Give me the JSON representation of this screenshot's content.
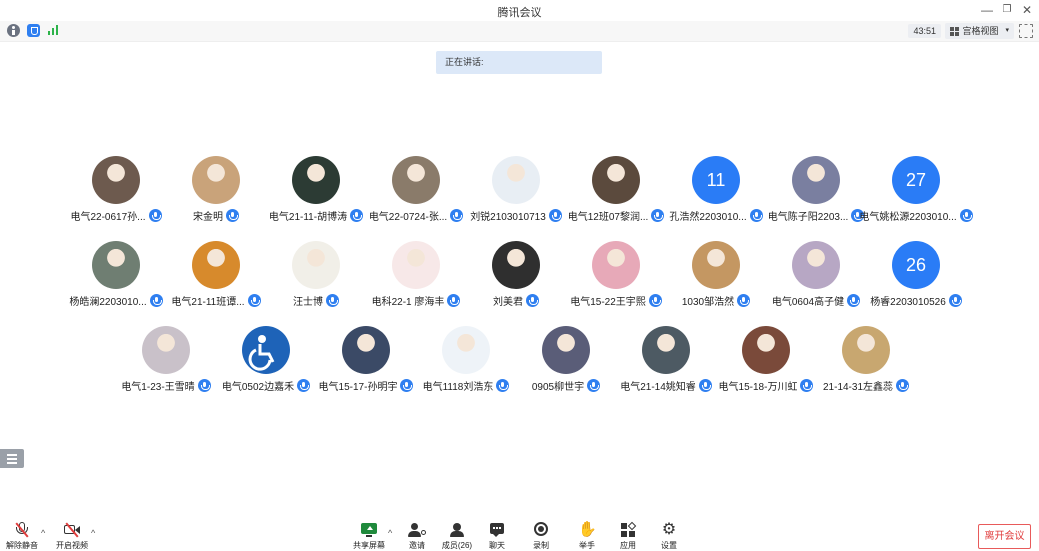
{
  "window": {
    "title": "腾讯会议"
  },
  "topbar": {
    "timer": "43:51",
    "view_label": "宫格视图"
  },
  "speaking": {
    "label": "正在讲话:"
  },
  "participants": [
    {
      "name": "电气22-0617孙...",
      "avatar": "photo",
      "color": "#6d5a4e"
    },
    {
      "name": "宋金明",
      "avatar": "photo",
      "color": "#c9a37a"
    },
    {
      "name": "电气21-11-胡博涛",
      "avatar": "photo",
      "color": "#2c3b34"
    },
    {
      "name": "电气22-0724-张...",
      "avatar": "photo",
      "color": "#8a7b6a"
    },
    {
      "name": "刘锐2103010713",
      "avatar": "photo",
      "color": "#e8eef4"
    },
    {
      "name": "电气12班07黎润...",
      "avatar": "photo",
      "color": "#5b4a3d"
    },
    {
      "name": "孔浩然2203010...",
      "avatar": "number",
      "number": "11"
    },
    {
      "name": "电气陈子阳2203...",
      "avatar": "photo",
      "color": "#7a7fa0"
    },
    {
      "name": "电气姚松源2203010...",
      "avatar": "number",
      "number": "27"
    },
    {
      "name": "杨皓澜2203010...",
      "avatar": "photo",
      "color": "#6f7e72"
    },
    {
      "name": "电气21-11班谭...",
      "avatar": "photo",
      "color": "#d78a2c"
    },
    {
      "name": "汪士博",
      "avatar": "photo",
      "color": "#f1efe8"
    },
    {
      "name": "电科22-1 廖海丰",
      "avatar": "photo",
      "color": "#f7e8e8"
    },
    {
      "name": "刘美君",
      "avatar": "photo",
      "color": "#2f2f2f"
    },
    {
      "name": "电气15-22王宇熙",
      "avatar": "photo",
      "color": "#e7a9b8"
    },
    {
      "name": "1030邹浩然",
      "avatar": "photo",
      "color": "#c49762"
    },
    {
      "name": "电气0604高子健",
      "avatar": "photo",
      "color": "#b7a7c4"
    },
    {
      "name": "杨睿2203010526",
      "avatar": "number",
      "number": "26"
    },
    {
      "name": "电气1-23-王雪晴",
      "avatar": "photo",
      "color": "#c9c1c9"
    },
    {
      "name": "电气0502边嘉禾",
      "avatar": "accessibility",
      "color": "#1e63b8"
    },
    {
      "name": "电气15-17-孙明宇",
      "avatar": "photo",
      "color": "#3b4a66"
    },
    {
      "name": "电气1118刘浩东",
      "avatar": "photo",
      "color": "#eef3f8"
    },
    {
      "name": "0905柳世宇",
      "avatar": "photo",
      "color": "#5a5d78"
    },
    {
      "name": "电气21-14姚知睿",
      "avatar": "photo",
      "color": "#4d5a63"
    },
    {
      "name": "电气15-18-万川虹",
      "avatar": "photo",
      "color": "#7a4a3a"
    },
    {
      "name": "21-14-31左鑫蕊",
      "avatar": "photo",
      "color": "#c8a770"
    }
  ],
  "toolbar": {
    "unmute": "解除静音",
    "start_video": "开启视频",
    "share_screen": "共享屏幕",
    "invite": "邀请",
    "members": "成员(26)",
    "chat": "聊天",
    "record": "录制",
    "raise_hand": "举手",
    "apps": "应用",
    "settings": "设置",
    "leave": "离开会议"
  },
  "colors": {
    "accent": "#2a7cf6",
    "leave": "#e03c3c",
    "speaking_bg": "#dce8f8"
  }
}
